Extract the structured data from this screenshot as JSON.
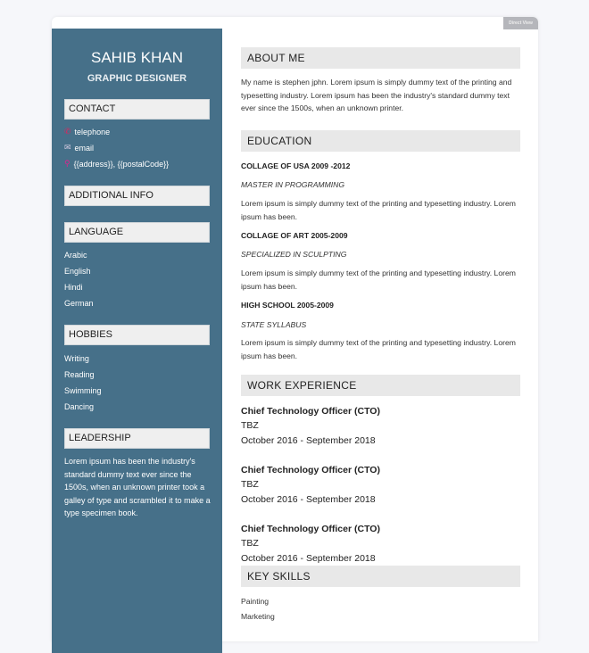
{
  "direct_view": "Direct View",
  "name": "SAHIB KHAN",
  "role": "GRAPHIC DESIGNER",
  "contact": {
    "title": "CONTACT",
    "items": [
      {
        "icon": "phone-icon",
        "text": "telephone"
      },
      {
        "icon": "mail-icon",
        "text": "email"
      },
      {
        "icon": "pin-icon",
        "text": "{{address}}, {{postalCode}}"
      }
    ]
  },
  "additional": {
    "title": "ADDITIONAL INFO"
  },
  "language": {
    "title": "LANGUAGE",
    "items": [
      "Arabic",
      "English",
      "Hindi",
      "German"
    ]
  },
  "hobbies": {
    "title": "HOBBIES",
    "items": [
      "Writing",
      "Reading",
      "Swimming",
      "Dancing"
    ]
  },
  "leadership": {
    "title": "LEADERSHIP",
    "text": "Lorem ipsum has been the industry's standard dummy text ever since the 1500s, when an unknown printer took a galley of type and scrambled it to make a type specimen book."
  },
  "about": {
    "title": "ABOUT ME",
    "text": "My name is stephen jphn. Lorem ipsum is simply dummy text of the printing and typesetting industry. Lorem ipsum has been the industry's standard dummy text ever since the 1500s, when an unknown printer."
  },
  "education": {
    "title": "EDUCATION",
    "items": [
      {
        "school": "COLLAGE OF USA 2009 -2012",
        "degree": "MASTER IN PROGRAMMING",
        "text": "Lorem ipsum is simply dummy text of the printing and typesetting industry. Lorem ipsum has been."
      },
      {
        "school": "COLLAGE OF ART 2005-2009",
        "degree": "SPECIALIZED IN SCULPTING",
        "text": "Lorem ipsum is simply dummy text of the printing and typesetting industry. Lorem ipsum has been."
      },
      {
        "school": "HIGH SCHOOL 2005-2009",
        "degree": "STATE SYLLABUS",
        "text": "Lorem ipsum is simply dummy text of the printing and typesetting industry. Lorem ipsum has been."
      }
    ]
  },
  "work": {
    "title": "WORK EXPERIENCE",
    "items": [
      {
        "role": "Chief Technology Officer (CTO)",
        "company": "TBZ",
        "dates": "October 2016 - September 2018"
      },
      {
        "role": "Chief Technology Officer (CTO)",
        "company": "TBZ",
        "dates": "October 2016 - September 2018"
      },
      {
        "role": "Chief Technology Officer (CTO)",
        "company": "TBZ",
        "dates": "October 2016 - September 2018"
      }
    ]
  },
  "skills": {
    "title": "KEY SKILLS",
    "items": [
      "Painting",
      "Marketing"
    ]
  }
}
